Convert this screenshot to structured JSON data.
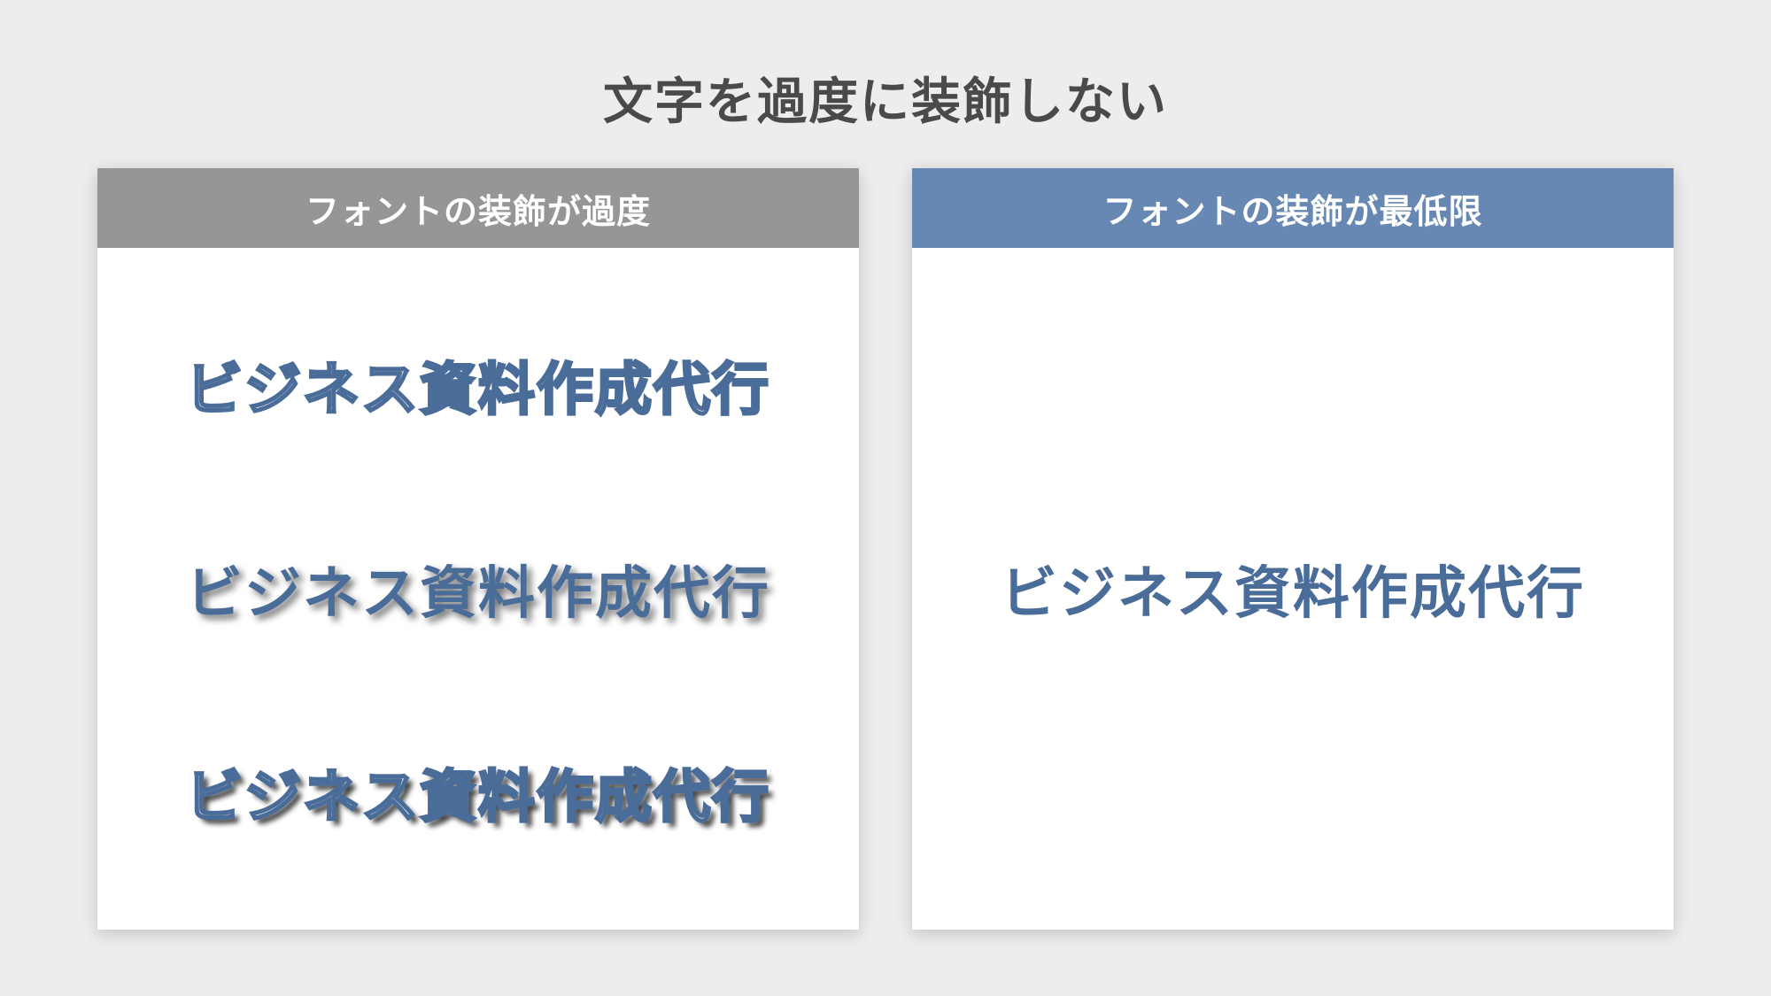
{
  "title": "文字を過度に装飾しない",
  "left": {
    "header": "フォントの装飾が過度",
    "sample1": "ビジネス資料作成代行",
    "sample2": "ビジネス資料作成代行",
    "sample3": "ビジネス資料作成代行"
  },
  "right": {
    "header": "フォントの装飾が最低限",
    "sample": "ビジネス資料作成代行"
  },
  "colors": {
    "accent_blue": "#4a6c98",
    "header_blue": "#6788b2",
    "header_grey": "#969696",
    "title_grey": "#4a4a4a",
    "bg": "#ededed"
  }
}
